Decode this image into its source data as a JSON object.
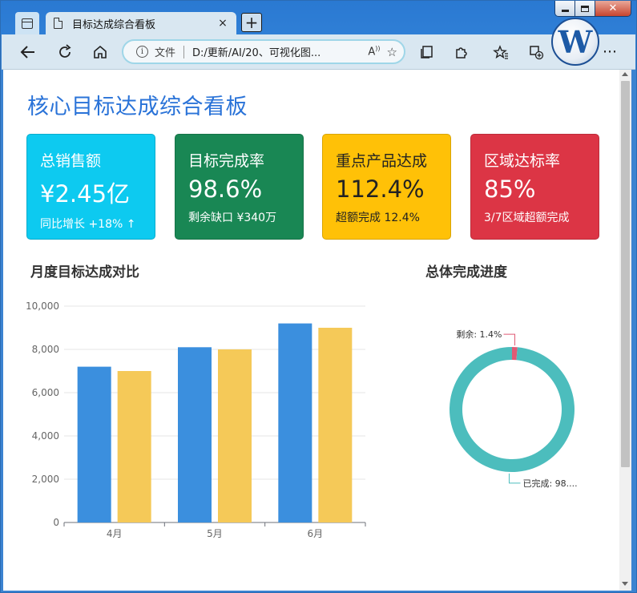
{
  "browser": {
    "tab_title": "目标达成综合看板",
    "address_protocol": "文件",
    "address_url": "D:/更新/AI/20、可视化图...",
    "read_aloud": "A͈",
    "new_tab": "+",
    "close_tab": "×"
  },
  "page": {
    "title": "核心目标达成综合看板"
  },
  "cards": [
    {
      "title": "总销售额",
      "value": "¥2.45亿",
      "sub": "同比增长 +18% ↑",
      "color": "#0dcaf0"
    },
    {
      "title": "目标完成率",
      "value": "98.6%",
      "sub": "剩余缺口 ¥340万",
      "color": "#198754"
    },
    {
      "title": "重点产品达成",
      "value": "112.4%",
      "sub": "超额完成 12.4%",
      "color": "#ffc107"
    },
    {
      "title": "区域达标率",
      "value": "85%",
      "sub": "3/7区域超额完成",
      "color": "#dc3545"
    }
  ],
  "sections": {
    "bar_title": "月度目标达成对比",
    "pie_title": "总体完成进度"
  },
  "chart_data": [
    {
      "type": "bar",
      "title": "月度目标达成对比",
      "categories": [
        "4月",
        "5月",
        "6月"
      ],
      "series": [
        {
          "values": [
            7200,
            8100,
            9200
          ],
          "color": "#3b8fde"
        },
        {
          "values": [
            7000,
            8000,
            9000
          ],
          "color": "#f5c958"
        }
      ],
      "ylim": [
        0,
        10000
      ],
      "yticks": [
        "0",
        "2,000",
        "4,000",
        "6,000",
        "8,000",
        "10,000"
      ],
      "grid": true
    },
    {
      "type": "pie",
      "title": "总体完成进度",
      "slices": [
        {
          "label": "剩余: 1.4%",
          "value": 1.4,
          "color": "#e05a74"
        },
        {
          "label": "已完成: 98....",
          "value": 98.6,
          "color": "#4cbdbd"
        }
      ]
    }
  ]
}
